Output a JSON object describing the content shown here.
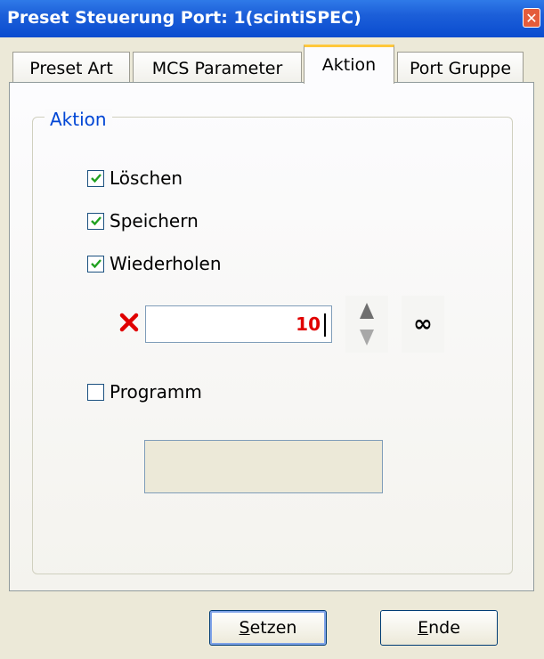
{
  "window": {
    "title": "Preset Steuerung Port: 1(scintiSPEC)",
    "close_glyph": "✕"
  },
  "tabs": [
    {
      "label": "Preset Art",
      "active": false
    },
    {
      "label": "MCS Parameter",
      "active": false
    },
    {
      "label": "Aktion",
      "active": true
    },
    {
      "label": "Port Gruppe",
      "active": false
    }
  ],
  "group": {
    "legend": "Aktion",
    "checkboxes": [
      {
        "label": "Löschen",
        "checked": true
      },
      {
        "label": "Speichern",
        "checked": true
      },
      {
        "label": "Wiederholen",
        "checked": true
      },
      {
        "label": "Programm",
        "checked": false
      }
    ],
    "repeat_count": "10",
    "infinity_glyph": "∞",
    "program_value": ""
  },
  "buttons": {
    "set_label_first": "S",
    "set_label_rest": "etzen",
    "end_label_first": "E",
    "end_label_rest": "nde"
  },
  "colors": {
    "titlebar": "#0a4ccf",
    "legend": "#0046d5",
    "count_text": "#e00000",
    "check_mark": "#21a121",
    "x_icon": "#e00000"
  }
}
